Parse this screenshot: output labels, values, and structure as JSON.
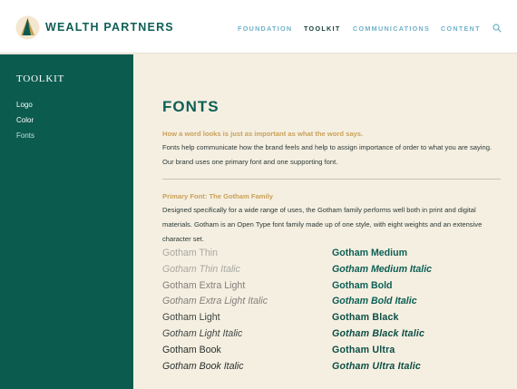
{
  "header": {
    "brand": "WEALTH PARTNERS",
    "nav": [
      "FOUNDATION",
      "TOOLKIT",
      "COMMUNICATIONS",
      "CONTENT"
    ],
    "active_nav": "TOOLKIT"
  },
  "sidebar": {
    "title": "TOOLKIT",
    "items": [
      {
        "label": "Logo"
      },
      {
        "label": "Color"
      },
      {
        "label": "Fonts"
      }
    ]
  },
  "main": {
    "title": "FONTS",
    "tagline": "How a word looks is just as important as what the word says.",
    "intro": "Fonts help communicate how the brand feels and help to assign importance of order to what you are saying. Our brand uses one primary font and one supporting font.",
    "primary_heading": "Primary Font: The Gotham Family",
    "primary_text": "Designed specifically for a wide range of uses, the Gotham family performs well both in print and digital materials. Gotham is an Open Type font family made up of one style, with eight weights and an extensive character set.",
    "left_samples": [
      "Gotham Thin",
      "Gotham Thin Italic",
      "Gotham Extra Light",
      "Gotham Extra Light Italic",
      "Gotham Light",
      "Gotham Light Italic",
      "Gotham Book",
      "Gotham Book Italic"
    ],
    "right_samples": [
      "Gotham Medium",
      "Gotham Medium Italic",
      "Gotham Bold",
      "Gotham Bold Italic",
      "Gotham Black",
      "Gotham Black Italic",
      "Gotham Ultra",
      "Gotham Ultra Italic"
    ]
  },
  "colors": {
    "brand_green": "#0c5b4f",
    "accent_gold": "#c9a15a",
    "nav_blue": "#6fb1c8",
    "background": "#f5efe1"
  },
  "icons": [
    "logo-mark-icon",
    "search-icon"
  ]
}
